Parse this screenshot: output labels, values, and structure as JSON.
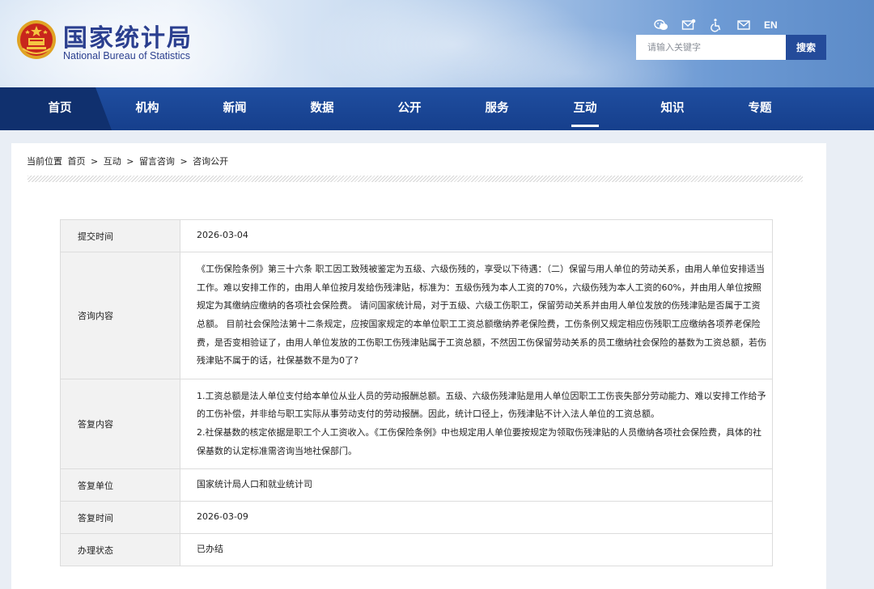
{
  "header": {
    "site_name_cn": "国家统计局",
    "site_name_en": "National Bureau of Statistics",
    "lang_switch": "EN",
    "icons": [
      "wechat-icon",
      "mail-icon",
      "accessibility-icon",
      "letter-icon"
    ],
    "search": {
      "placeholder": "请输入关键字",
      "button_label": "搜索"
    }
  },
  "nav": {
    "items": [
      {
        "label": "首页"
      },
      {
        "label": "机构"
      },
      {
        "label": "新闻"
      },
      {
        "label": "数据"
      },
      {
        "label": "公开"
      },
      {
        "label": "服务"
      },
      {
        "label": "互动"
      },
      {
        "label": "知识"
      },
      {
        "label": "专题"
      }
    ],
    "active": "互动"
  },
  "breadcrumb": {
    "prefix": "当前位置",
    "items": [
      "首页",
      "互动",
      "留言咨询",
      "咨询公开"
    ],
    "separator": ">"
  },
  "record": {
    "submit_time": {
      "label": "提交时间",
      "value": "2026-03-04"
    },
    "question": {
      "label": "咨询内容",
      "value": "《工伤保险条例》第三十六条 职工因工致残被鉴定为五级、六级伤残的，享受以下待遇：（二）保留与用人单位的劳动关系，由用人单位安排适当工作。难以安排工作的，由用人单位按月发给伤残津贴，标准为：五级伤残为本人工资的70%，六级伤残为本人工资的60%，并由用人单位按照规定为其缴纳应缴纳的各项社会保险费。 请问国家统计局，对于五级、六级工伤职工，保留劳动关系并由用人单位发放的伤残津贴是否属于工资总额。 目前社会保险法第十二条规定，应按国家规定的本单位职工工资总额缴纳养老保险费，工伤条例又规定相应伤残职工应缴纳各项养老保险费，是否变相验证了，由用人单位发放的工伤职工伤残津贴属于工资总额，不然因工伤保留劳动关系的员工缴纳社会保险的基数为工资总额，若伤残津贴不属于的话，社保基数不是为0了?"
    },
    "answer": {
      "label": "答复内容",
      "paragraphs": [
        "1.工资总额是法人单位支付给本单位从业人员的劳动报酬总额。五级、六级伤残津贴是用人单位因职工工伤丧失部分劳动能力、难以安排工作给予的工伤补偿，并非给与职工实际从事劳动支付的劳动报酬。因此，统计口径上，伤残津贴不计入法人单位的工资总额。",
        "2.社保基数的核定依据是职工个人工资收入。《工伤保险条例》中也规定用人单位要按规定为领取伤残津贴的人员缴纳各项社会保险费，具体的社保基数的认定标准需咨询当地社保部门。"
      ]
    },
    "reply_unit": {
      "label": "答复单位",
      "value": "国家统计局人口和就业统计司"
    },
    "reply_time": {
      "label": "答复时间",
      "value": "2026-03-09"
    },
    "status": {
      "label": "办理状态",
      "value": "已办结"
    }
  },
  "colors": {
    "nav_bg": "#1a4796",
    "nav_home_bg": "#10306e",
    "search_button": "#244b9a",
    "logo_text": "#2b3f8f",
    "label_cell_bg": "#f2f2f2"
  }
}
